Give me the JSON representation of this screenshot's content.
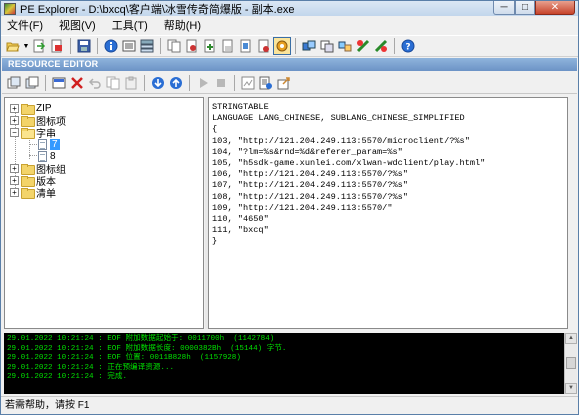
{
  "window": {
    "title": "PE Explorer - D:\\bxcq\\客户端\\冰雪传奇简爆版 - 副本.exe",
    "minimize": "─",
    "maximize": "□",
    "close": "✕"
  },
  "menu": [
    "文件(F)",
    "视图(V)",
    "工具(T)",
    "帮助(H)"
  ],
  "toolbar_icons": [
    "open-folder-icon",
    "dropdown-arrow-icon",
    "export-icon",
    "pdf-icon",
    "save-icon",
    "info-icon",
    "headers-icon",
    "sections-icon",
    "copy-icon",
    "resources-icon",
    "add-resource-icon",
    "delete-resource-icon",
    "disassembler-icon",
    "dependency-icon",
    "resource-editor-icon",
    "tools-icon",
    "options-icon",
    "plugins-icon",
    "settings-icon",
    "checklist-icon",
    "help-icon"
  ],
  "resource_editor": {
    "header": "RESOURCE EDITOR"
  },
  "tree": {
    "items": [
      {
        "label": "ZIP",
        "expander": "+"
      },
      {
        "label": "图标项",
        "expander": "+"
      },
      {
        "label": "字串",
        "expander": "−"
      },
      {
        "label": "7",
        "selected": true
      },
      {
        "label": "8"
      },
      {
        "label": "图标组",
        "expander": "+"
      },
      {
        "label": "版本",
        "expander": "+"
      },
      {
        "label": "清单",
        "expander": "+"
      }
    ]
  },
  "editor": {
    "lines": [
      "STRINGTABLE",
      "LANGUAGE LANG_CHINESE, SUBLANG_CHINESE_SIMPLIFIED",
      "{",
      "103, \"http://121.204.249.113:5570/microclient/?%s\"",
      "104, \"?lm=%s&rnd=%d&referer_param=%s\"",
      "105, \"h5sdk-game.xunlei.com/xlwan-wdclient/play.html\"",
      "106, \"http://121.204.249.113:5570/?%s\"",
      "107, \"http://121.204.249.113:5570/?%s\"",
      "108, \"http://121.204.249.113:5570/?%s\"",
      "109, \"http://121.204.249.113:5570/\"",
      "110, \"4650\"",
      "111, \"bxcq\"",
      "}"
    ]
  },
  "log": {
    "lines": [
      "29.01.2022 10:21:24 : EOF 附加数据起始于: 0011700h  (1142784)",
      "29.01.2022 10:21:24 : EOF 附加数据长度: 0000382Bh  (15144) 字节.",
      "29.01.2022 10:21:24 : EOF 位置: 0011B828h  (1157928)",
      "29.01.2022 10:21:24 : 正在预编译资源...",
      "29.01.2022 10:21:24 : 完成."
    ],
    "color": "#00e000"
  },
  "statusbar": {
    "text": "若需帮助，请按 F1"
  }
}
